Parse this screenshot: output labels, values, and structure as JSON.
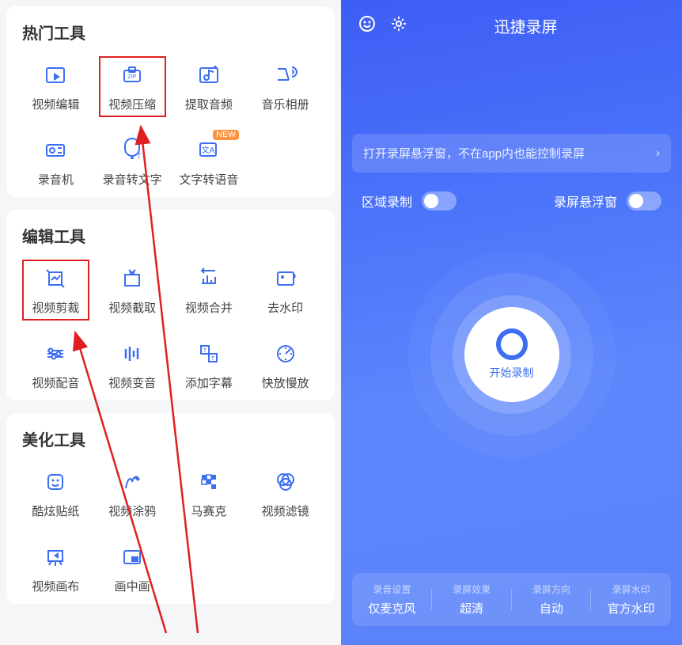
{
  "left": {
    "sections": [
      {
        "title": "热门工具",
        "items": [
          {
            "label": "视频编辑",
            "icon": "video-edit-icon",
            "highlight": false,
            "badge": null
          },
          {
            "label": "视频压缩",
            "icon": "zip-icon",
            "highlight": true,
            "badge": null
          },
          {
            "label": "提取音频",
            "icon": "music-extract-icon",
            "highlight": false,
            "badge": null
          },
          {
            "label": "音乐相册",
            "icon": "music-album-icon",
            "highlight": false,
            "badge": null
          },
          {
            "label": "录音机",
            "icon": "recorder-icon",
            "highlight": false,
            "badge": null
          },
          {
            "label": "录音转文字",
            "icon": "speech-to-text-icon",
            "highlight": false,
            "badge": null
          },
          {
            "label": "文字转语音",
            "icon": "text-to-speech-icon",
            "highlight": false,
            "badge": "NEW"
          }
        ]
      },
      {
        "title": "编辑工具",
        "items": [
          {
            "label": "视频剪裁",
            "icon": "crop-icon",
            "highlight": true,
            "badge": null
          },
          {
            "label": "视频截取",
            "icon": "cut-icon",
            "highlight": false,
            "badge": null
          },
          {
            "label": "视频合并",
            "icon": "merge-icon",
            "highlight": false,
            "badge": null
          },
          {
            "label": "去水印",
            "icon": "watermark-remove-icon",
            "highlight": false,
            "badge": null
          },
          {
            "label": "视频配音",
            "icon": "dub-icon",
            "highlight": false,
            "badge": null
          },
          {
            "label": "视频变音",
            "icon": "pitch-icon",
            "highlight": false,
            "badge": null
          },
          {
            "label": "添加字幕",
            "icon": "subtitle-icon",
            "highlight": false,
            "badge": null
          },
          {
            "label": "快放慢放",
            "icon": "speed-icon",
            "highlight": false,
            "badge": null
          }
        ]
      },
      {
        "title": "美化工具",
        "items": [
          {
            "label": "酷炫贴纸",
            "icon": "sticker-icon",
            "highlight": false,
            "badge": null
          },
          {
            "label": "视频涂鸦",
            "icon": "doodle-icon",
            "highlight": false,
            "badge": null
          },
          {
            "label": "马赛克",
            "icon": "mosaic-icon",
            "highlight": false,
            "badge": null
          },
          {
            "label": "视频滤镜",
            "icon": "filter-icon",
            "highlight": false,
            "badge": null
          },
          {
            "label": "视频画布",
            "icon": "canvas-icon",
            "highlight": false,
            "badge": null
          },
          {
            "label": "画中画",
            "icon": "pip-icon",
            "highlight": false,
            "badge": null
          }
        ]
      }
    ]
  },
  "right": {
    "title": "迅捷录屏",
    "tip": "打开录屏悬浮窗，不在app内也能控制录屏",
    "toggles": [
      {
        "label": "区域录制",
        "on": false
      },
      {
        "label": "录屏悬浮窗",
        "on": false
      }
    ],
    "record_button": "开始录制",
    "settings": [
      {
        "label": "录音设置",
        "value": "仅麦克风"
      },
      {
        "label": "录屏效果",
        "value": "超清"
      },
      {
        "label": "录屏方向",
        "value": "自动"
      },
      {
        "label": "录屏水印",
        "value": "官方水印"
      }
    ]
  }
}
